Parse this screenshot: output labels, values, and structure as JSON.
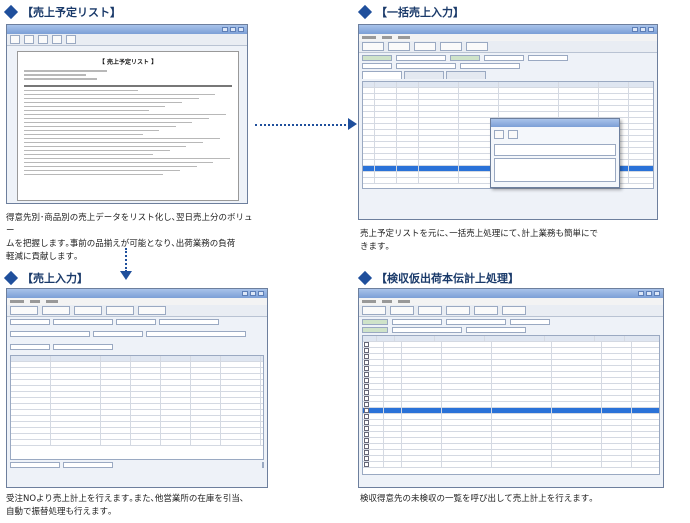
{
  "sections": {
    "sales_plan_list": {
      "title": "【売上予定リスト】",
      "description_lines": [
        "得意先別･商品別の売上データをリスト化し､翌日売上分のボリュー",
        "ムを把握します｡事前の品揃えが可能となり､出荷業務の負荷",
        "軽減に貢献します｡"
      ],
      "report_title": "【 売上予定リスト 】"
    },
    "bulk_sales_input": {
      "title": "【一括売上入力】",
      "description_lines": [
        "売上予定リストを元に､一括売上処理にて､計上業務も簡単にで",
        "きます｡"
      ]
    },
    "sales_input": {
      "title": "【売上入力】",
      "description_lines": [
        "受注NOより売上計上を行えます｡また､他営業所の在庫を引当､",
        "自動で振替処理も行えます｡"
      ]
    },
    "inspection_shipment": {
      "title": "【検収仮出荷本伝計上処理】",
      "description_lines": [
        "検収得意先の未検収の一覧を呼び出して売上計上を行えます｡"
      ]
    }
  },
  "colors": {
    "accent": "#1f4f9c",
    "selection": "#2a72d8"
  }
}
